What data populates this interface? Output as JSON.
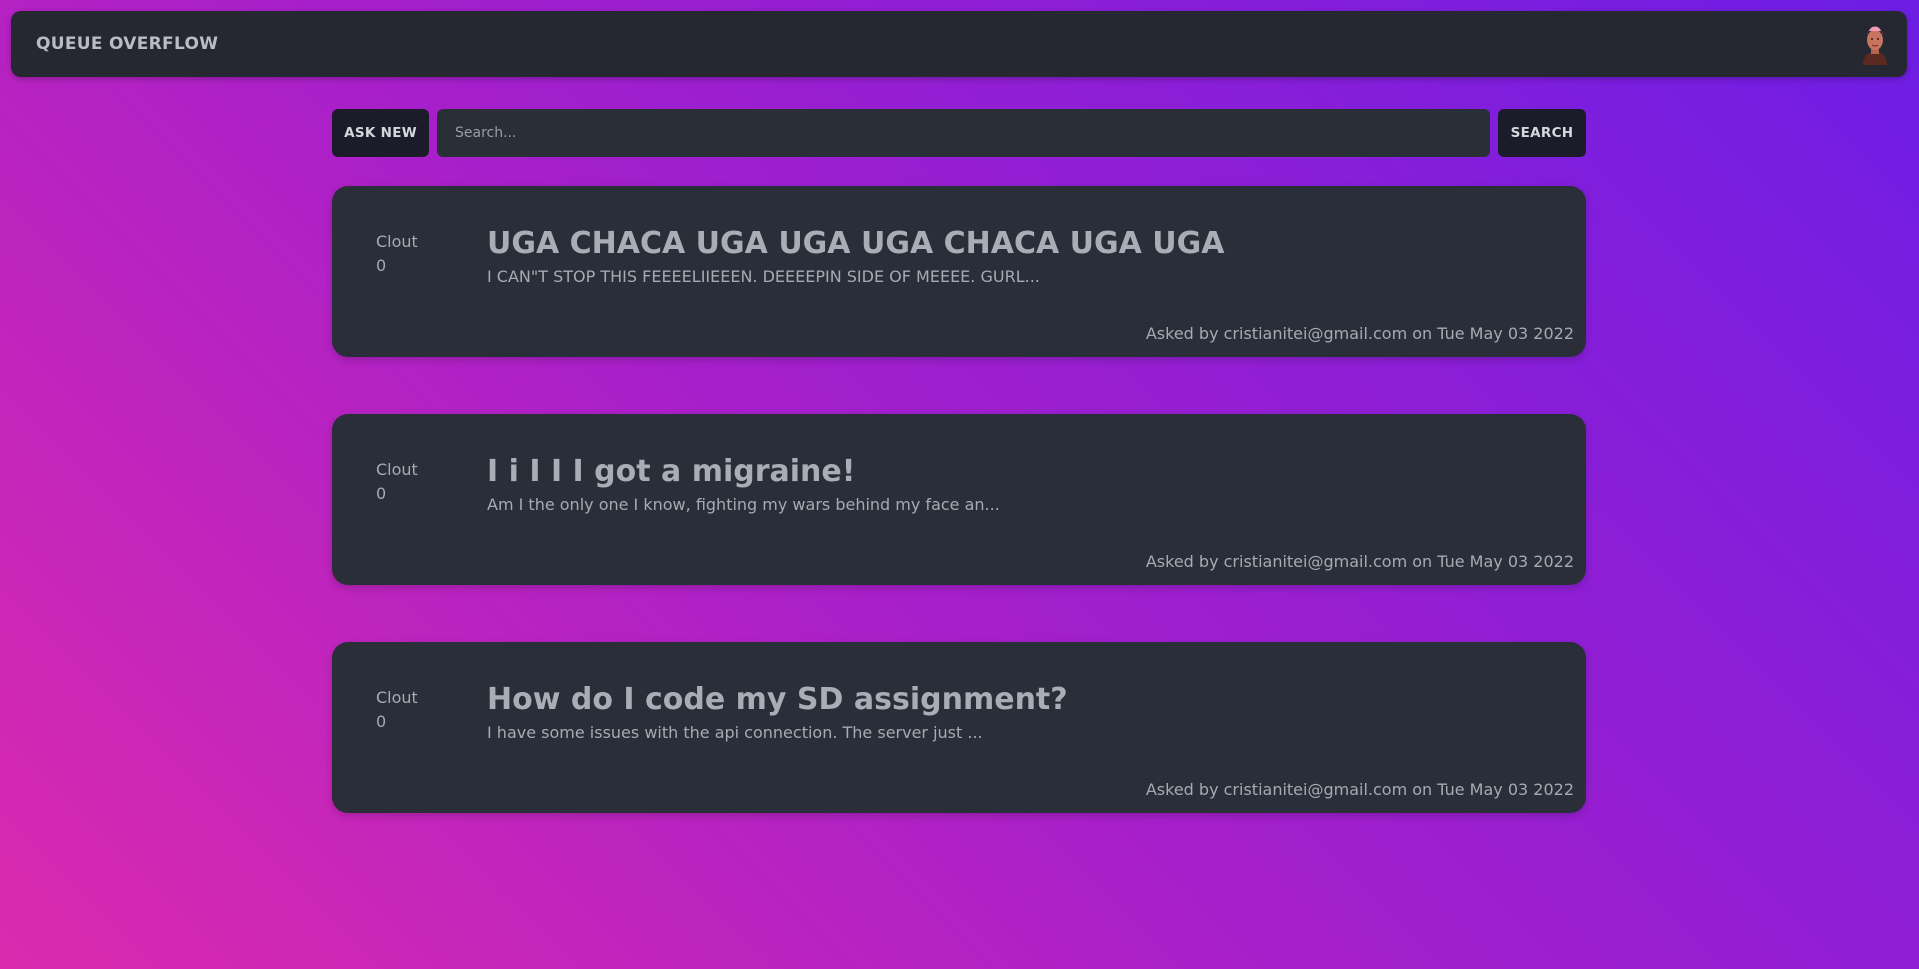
{
  "navbar": {
    "brand": "QUEUE OVERFLOW",
    "avatar_icon": "user-avatar"
  },
  "toolbar": {
    "ask_label": "ASK NEW",
    "search_placeholder": "Search...",
    "search_value": "",
    "search_label": "SEARCH"
  },
  "questions": [
    {
      "clout_label": "Clout",
      "clout_value": "0",
      "title": "UGA CHACA UGA UGA UGA CHACA UGA UGA",
      "excerpt": "I CAN\"T STOP THIS FEEEELIIEEEN. DEEEEPIN SIDE OF MEEEE. GURL...",
      "meta": "Asked by cristianitei@gmail.com on Tue May 03 2022"
    },
    {
      "clout_label": "Clout",
      "clout_value": "0",
      "title": "I i I I I got a migraine!",
      "excerpt": "Am I the only one I know, fighting my wars behind my face an...",
      "meta": "Asked by cristianitei@gmail.com on Tue May 03 2022"
    },
    {
      "clout_label": "Clout",
      "clout_value": "0",
      "title": "How do I code my SD assignment?",
      "excerpt": "I have some issues with the api connection. The server just ...",
      "meta": "Asked by cristianitei@gmail.com on Tue May 03 2022"
    }
  ],
  "colors": {
    "background_gradient_start": "#db2aae",
    "background_gradient_end": "#6d1de5",
    "navbar": "#252830",
    "card": "#2a2e38",
    "button": "#1c1b29",
    "text": "#a6aab2"
  }
}
